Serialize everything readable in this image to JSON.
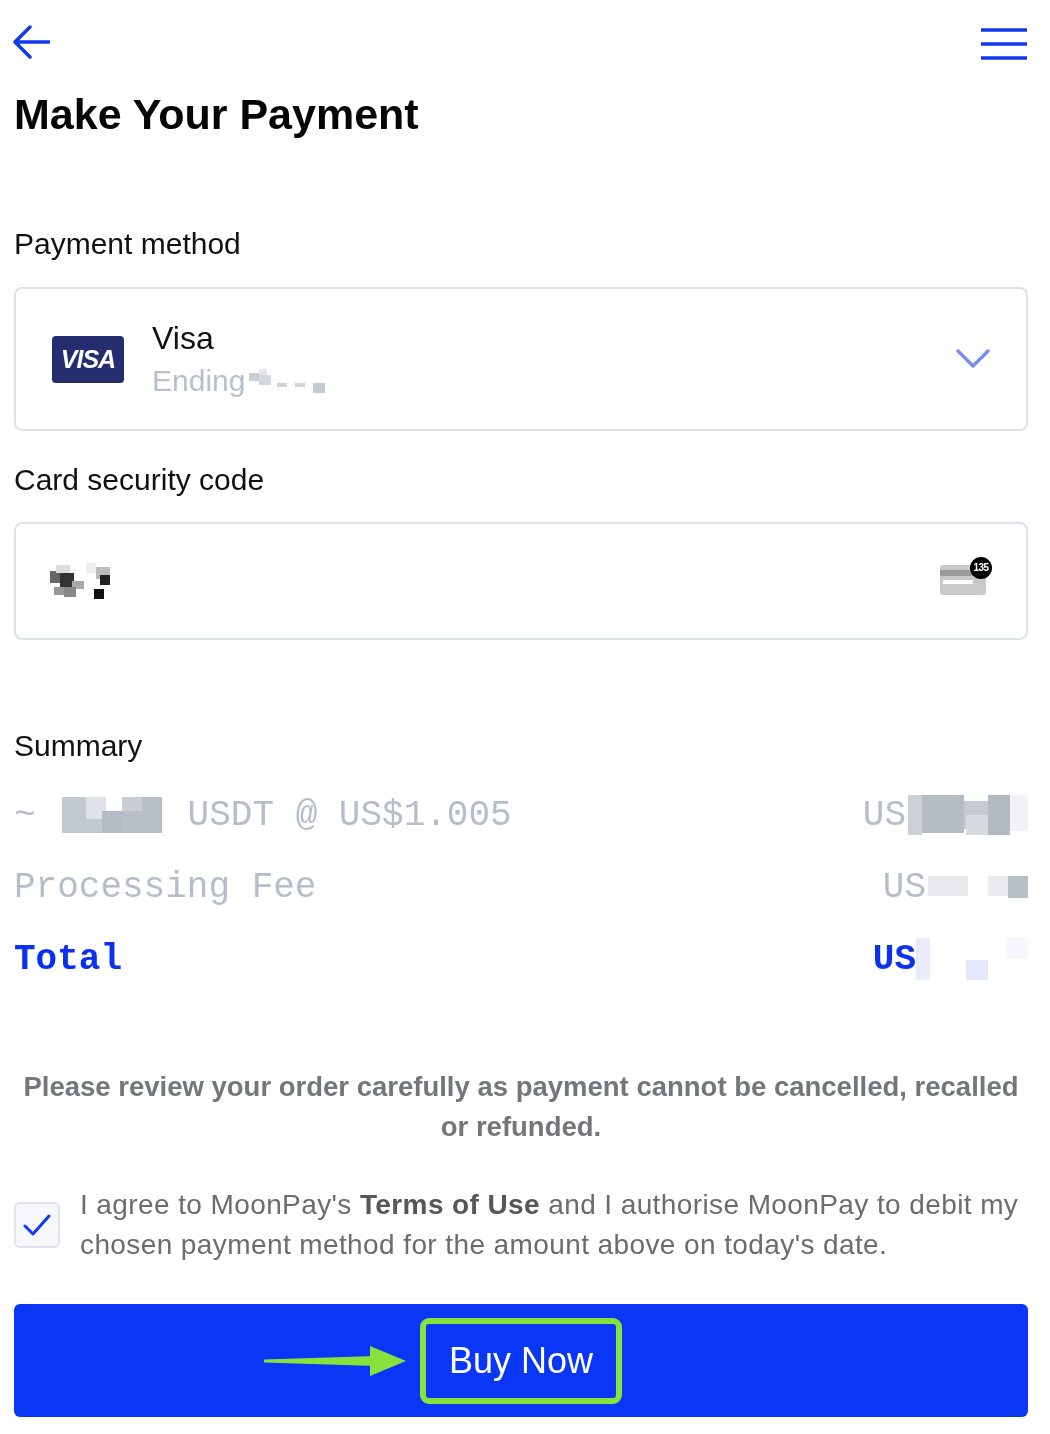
{
  "header": {
    "title": "Make Your Payment"
  },
  "payment_method": {
    "label": "Payment method",
    "card": {
      "logo_text": "VISA",
      "name": "Visa",
      "detail": "Ending"
    }
  },
  "security_code": {
    "label": "Card security code",
    "hint_badge": "135"
  },
  "summary": {
    "title": "Summary",
    "rows": [
      {
        "kind": "rate",
        "prefix": "~",
        "label": "USDT @ US$1.005",
        "amount": "US"
      },
      {
        "kind": "fee",
        "label": "Processing Fee",
        "amount": "US"
      },
      {
        "kind": "total",
        "label": "Total",
        "amount": "US"
      }
    ]
  },
  "notice": "Please review your order carefully as payment cannot be cancelled, recalled or refunded.",
  "agreement": {
    "text": "I agree to MoonPay's **Terms of Use** and I authorise MoonPay to debit my chosen payment method for the amount above on today's date.",
    "checked": true
  },
  "button": {
    "label": "Buy Now"
  }
}
